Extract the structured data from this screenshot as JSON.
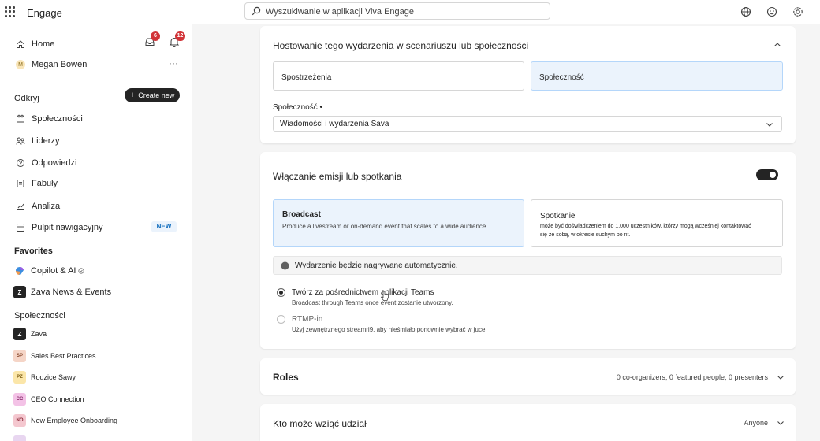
{
  "header": {
    "app_name": "Engage",
    "search_placeholder": "Wyszukiwanie w aplikacji Viva Engage"
  },
  "sidebar": {
    "home": "Home",
    "inbox_count": "6",
    "notif_count": "12",
    "user": "Megan Bowen",
    "user_initial": "M",
    "more": "···",
    "discover": "Odkryj",
    "create_new": "Create new",
    "nav": [
      "Społeczności",
      "Liderzy",
      "Odpowiedzi",
      "Fabuły",
      "Analiza",
      "Pulpit nawigacyjny"
    ],
    "new_tag": "NEW",
    "favorites_title": "Favorites",
    "favorites": [
      "Copilot & AI",
      "Zava News & Events"
    ],
    "communities_title": "Społeczności",
    "communities": [
      {
        "initials": "Z",
        "name": "Zava"
      },
      {
        "initials": "SP",
        "name": "Sales Best Practices"
      },
      {
        "initials": "PZ",
        "name": "Rodzice Sawy"
      },
      {
        "initials": "CC",
        "name": "CEO Connection"
      },
      {
        "initials": "NO",
        "name": "New Employee Onboarding"
      }
    ]
  },
  "hosting": {
    "title": "Hostowanie tego wydarzenia w scenariuszu lub społeczności",
    "option_a": "Spostrzeżenia",
    "option_b": "Społeczność",
    "field_label": "Społeczność •",
    "field_value": "Wiadomości i wydarzenia Sava"
  },
  "broadcast": {
    "title": "Włączanie emisji lub spotkania",
    "opt1_title": "Broadcast",
    "opt1_desc": "Produce a livestream or on-demand event that scales to a wide audience.",
    "opt2_title": "Spotkanie",
    "opt2_desc": "może być doświadczeniem do 1,000 uczestników, którzy mogą wcześniej kontaktować się ze sobą, w okresie suchym po nt.",
    "info": "Wydarzenie będzie nagrywane automatycznie.",
    "radio1_label": "Twórz za pośrednictwem aplikacji Teams",
    "radio1_desc": "Broadcast through Teams once event zostanie utworzony.",
    "radio2_label": "RTMP-in",
    "radio2_desc": "Użyj zewnętrznego streamri9, aby nieśmiało ponownie wybrać w juce."
  },
  "roles": {
    "title": "Roles",
    "summary": "0 co-organizers, 0 featured people, 0 presenters"
  },
  "attend": {
    "title": "Kto może wziąć udział",
    "value": "Anyone"
  }
}
